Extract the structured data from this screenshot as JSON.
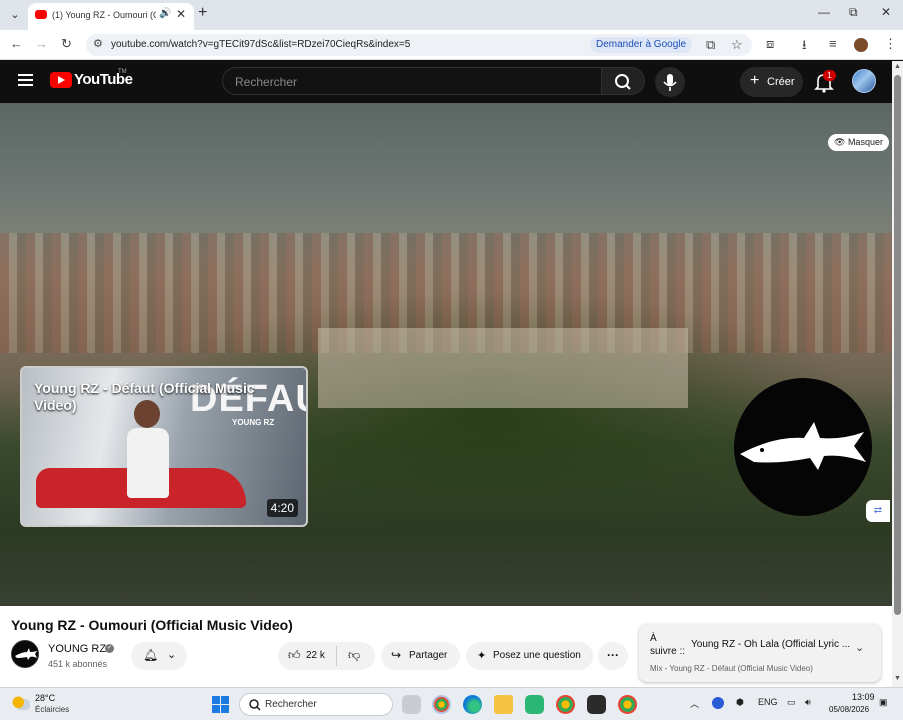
{
  "browser": {
    "tab": {
      "title": "(1) Young RZ - Oumouri (Offi",
      "audio_icon": "speaker-icon",
      "close": "✕"
    },
    "new_tab": "+",
    "window_controls": {
      "minimize": "—",
      "maximize": "⧉",
      "close": "✕"
    },
    "toolbar": {
      "back": "←",
      "forward": "→",
      "reload": "↻",
      "url": "youtube.com/watch?v=gTECit97dSc&list=RDzei70CieqRs&index=5",
      "ask_google": "Demander à Google",
      "bookmark": "☆",
      "menu": "⋮"
    }
  },
  "youtube": {
    "logo_text": "YouTube",
    "logo_tm": "TM",
    "search_placeholder": "Rechercher",
    "create_label": "Créer",
    "notif_count": "1",
    "colors": {
      "brand": "#ff0000",
      "badge": "#cc0000"
    }
  },
  "video": {
    "hide_button": "Masquer",
    "endcard": {
      "title": "Young RZ - Défaut (Official Music Video)",
      "art_text": "DÉFAUT",
      "art_sub": "YOUNG RZ",
      "duration": "4:20"
    }
  },
  "below": {
    "title": "Young RZ - Oumouri (Official Music Video)",
    "channel_name": "YOUNG RZ",
    "subscribers": "451 k abonnés",
    "likes": "22 k",
    "share_label": "Partager",
    "ask_label": "Posez une question",
    "next": {
      "a_suivre_1": "À",
      "a_suivre_2": "suivre ::",
      "title": "Young RZ - Oh Lala (Official Lyric ...",
      "subtitle": "Mix - Young RZ - Défaut (Official Music Video)"
    }
  },
  "taskbar": {
    "weather_temp": "28°C",
    "weather_desc": "Éclaircies",
    "search_label": "Rechercher",
    "lang": "ENG",
    "time": "13:09",
    "date": "05/08/2026"
  }
}
